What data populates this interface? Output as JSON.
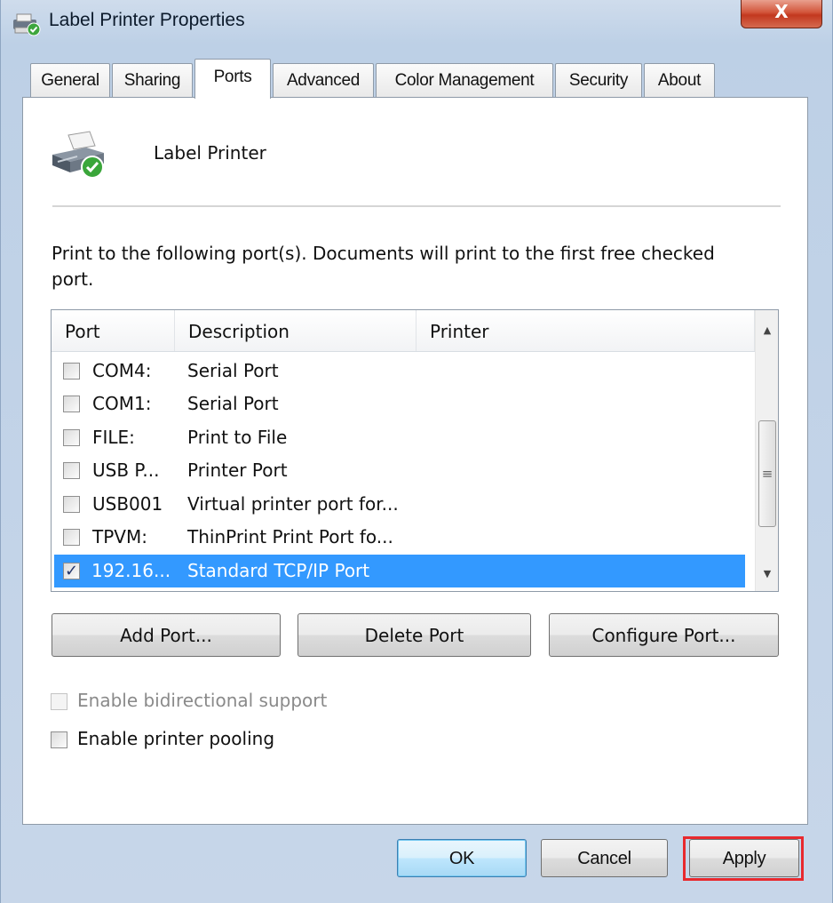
{
  "window": {
    "title": "Label Printer Properties",
    "close_label": "X"
  },
  "tabs": [
    {
      "label": "General"
    },
    {
      "label": "Sharing"
    },
    {
      "label": "Ports"
    },
    {
      "label": "Advanced"
    },
    {
      "label": "Color Management"
    },
    {
      "label": "Security"
    },
    {
      "label": "About"
    }
  ],
  "active_tab": "Ports",
  "printer": {
    "name": "Label Printer"
  },
  "instruction": "Print to the following port(s). Documents will print to the first free checked port.",
  "port_list": {
    "columns": [
      "Port",
      "Description",
      "Printer"
    ],
    "rows": [
      {
        "port": "COM4:",
        "description": "Serial Port",
        "printer": "",
        "checked": false,
        "selected": false
      },
      {
        "port": "COM1:",
        "description": "Serial Port",
        "printer": "",
        "checked": false,
        "selected": false
      },
      {
        "port": "FILE:",
        "description": "Print to File",
        "printer": "",
        "checked": false,
        "selected": false
      },
      {
        "port": "USB P...",
        "description": "Printer Port",
        "printer": "",
        "checked": false,
        "selected": false
      },
      {
        "port": "USB001",
        "description": "Virtual printer port for...",
        "printer": "",
        "checked": false,
        "selected": false
      },
      {
        "port": "TPVM:",
        "description": "ThinPrint Print Port fo...",
        "printer": "",
        "checked": false,
        "selected": false
      },
      {
        "port": "192.16...",
        "description": "Standard TCP/IP Port",
        "printer": "",
        "checked": true,
        "selected": true
      }
    ],
    "scroll_thumb_glyph": "≡",
    "scroll_up_glyph": "▲",
    "scroll_down_glyph": "▼"
  },
  "port_buttons": {
    "add": "Add Port...",
    "delete": "Delete Port",
    "configure": "Configure Port..."
  },
  "options": {
    "bidirectional": {
      "label": "Enable bidirectional support",
      "checked": false,
      "enabled": false
    },
    "pooling": {
      "label": "Enable printer pooling",
      "checked": false,
      "enabled": true
    }
  },
  "footer": {
    "ok": "OK",
    "cancel": "Cancel",
    "apply": "Apply"
  },
  "colors": {
    "selection": "#3399ff",
    "highlight_box": "#e8292e"
  }
}
